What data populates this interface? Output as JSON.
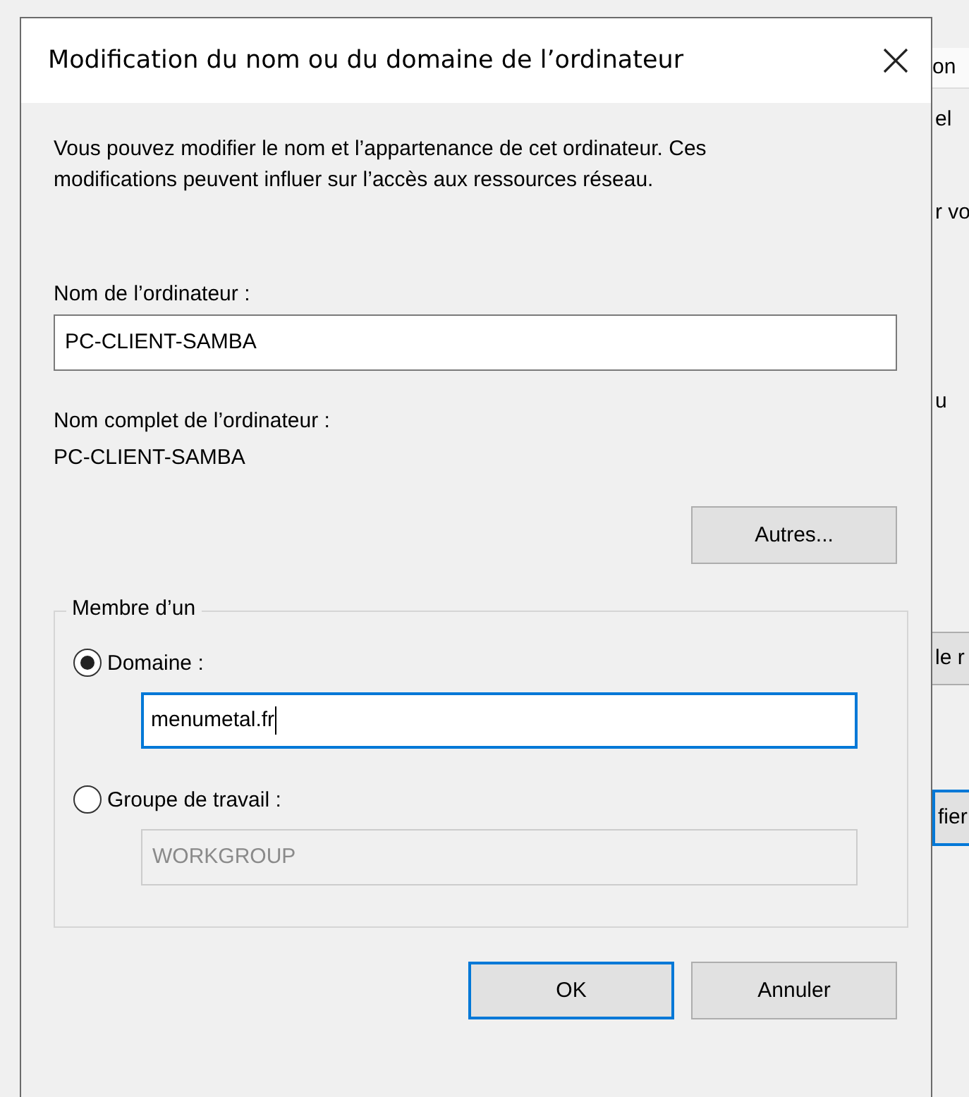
{
  "window": {
    "title": "Modification du nom ou du domaine de l’ordinateur"
  },
  "description": "Vous pouvez modifier le nom et l’appartenance de cet ordinateur. Ces modifications peuvent influer sur l’accès aux ressources réseau.",
  "computer_name": {
    "label": "Nom de l’ordinateur :",
    "value": "PC-CLIENT-SAMBA"
  },
  "full_name": {
    "label": "Nom complet de l’ordinateur :",
    "value": "PC-CLIENT-SAMBA"
  },
  "other_button": "Autres...",
  "member_of": {
    "legend": "Membre d’un",
    "options": [
      {
        "label": "Domaine :",
        "selected": true,
        "value": "menumetal.fr",
        "disabled": false,
        "focused": true
      },
      {
        "label": "Groupe de travail :",
        "selected": false,
        "value": "WORKGROUP",
        "disabled": true,
        "focused": false
      }
    ]
  },
  "buttons": [
    {
      "label": "OK",
      "default": true
    },
    {
      "label": "Annuler",
      "default": false
    }
  ],
  "background_window": {
    "fragments": [
      {
        "kind": "tab",
        "text": "on"
      },
      {
        "kind": "text",
        "text": "el"
      },
      {
        "kind": "text",
        "text": "r vo"
      },
      {
        "kind": "text",
        "text": "u"
      },
      {
        "kind": "button",
        "text": "le r"
      },
      {
        "kind": "default_button",
        "text": "fier"
      }
    ]
  }
}
